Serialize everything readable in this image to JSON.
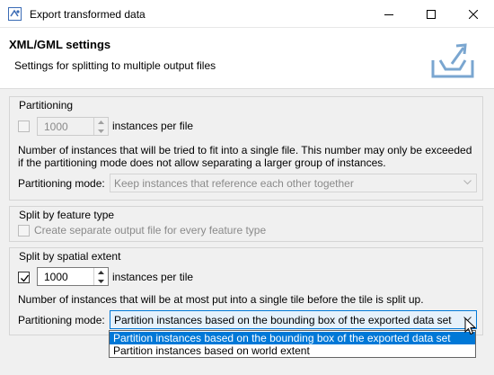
{
  "window": {
    "title": "Export transformed data",
    "icon": "app-icon",
    "controls": [
      "minimize-icon",
      "maximize-icon",
      "close-icon"
    ]
  },
  "header": {
    "title": "XML/GML settings",
    "description": "Settings for splitting to multiple output files",
    "icon": "export-icon"
  },
  "partitioning": {
    "legend": "Partitioning",
    "enabled": false,
    "count": "1000",
    "unit_label": "instances per file",
    "help_line1": "Number of instances that will be tried to fit into a single file. This number may only be exceeded",
    "help_line2": "if the partitioning mode does not allow separating a larger group of instances.",
    "mode_label": "Partitioning mode:",
    "mode_value": "Keep instances that reference each other together"
  },
  "feature_type": {
    "legend": "Split by feature type",
    "checkbox_label": "Create separate output file for every feature type",
    "checked": false
  },
  "spatial": {
    "legend": "Split by spatial extent",
    "checked": true,
    "count": "1000",
    "unit_label": "instances per tile",
    "help": "Number of instances that will be at most put into a single tile before the tile is split up.",
    "mode_label": "Partitioning mode:",
    "mode_value": "Partition instances based on the bounding box of the exported data set",
    "options": [
      "Partition instances based on the bounding box of the exported data set",
      "Partition instances based on world extent"
    ],
    "selected_option": 0
  },
  "colors": {
    "accent": "#0078d7",
    "background": "#f0f0f0",
    "header_bg": "#ffffff"
  }
}
